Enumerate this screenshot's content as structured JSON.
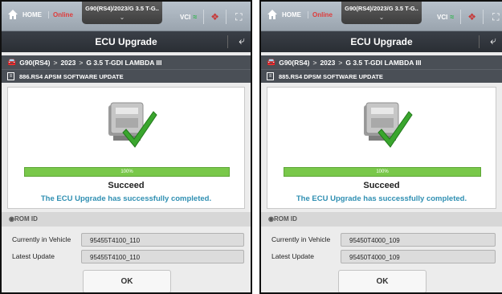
{
  "panels": [
    {
      "topbar": {
        "home_label": "HOME",
        "status": "Online",
        "vehicle": "G90(RS4)/2023/G 3.5 T-G..",
        "vci_label": "VCI"
      },
      "title": "ECU Upgrade",
      "path": {
        "model": "G90(RS4)",
        "year": "2023",
        "engine": "G 3.5 T-GDI LAMBDA III"
      },
      "update_item": "886.RS4 APSM SOFTWARE UPDATE",
      "progress": {
        "percent": 100,
        "label": "100%"
      },
      "status": "Succeed",
      "message": "The ECU Upgrade has successfully completed.",
      "rom": {
        "header": "ROM ID",
        "current_label": "Currently in Vehicle",
        "current_value": "95455T4100_110",
        "latest_label": "Latest Update",
        "latest_value": "95455T4100_110"
      },
      "ok_label": "OK"
    },
    {
      "topbar": {
        "home_label": "HOME",
        "status": "Online",
        "vehicle": "G90(RS4)/2023/G 3.5 T-G..",
        "vci_label": "VCI"
      },
      "title": "ECU Upgrade",
      "path": {
        "model": "G90(RS4)",
        "year": "2023",
        "engine": "G 3.5 T-GDI LAMBDA III"
      },
      "update_item": "885.RS4 DPSM SOFTWARE UPDATE",
      "progress": {
        "percent": 100,
        "label": "100%"
      },
      "status": "Succeed",
      "message": "The ECU Upgrade has successfully completed.",
      "rom": {
        "header": "ROM ID",
        "current_label": "Currently in Vehicle",
        "current_value": "95450T4000_109",
        "latest_label": "Latest Update",
        "latest_value": "95450T4000_109"
      },
      "ok_label": "OK"
    }
  ],
  "icons": {
    "home": "home-icon",
    "vci": "vci-connection-icon",
    "globe": "globe-icon",
    "expand": "expand-icon",
    "back": "back-arrow-icon",
    "car": "car-icon",
    "document": "document-icon",
    "ecu": "ecu-module-icon",
    "check": "checkmark-icon"
  },
  "colors": {
    "online": "#e03a3a",
    "progress": "#79c84a",
    "message": "#2f8fb2",
    "titlebar": "#2a2e34",
    "check": "#3aa62e"
  }
}
